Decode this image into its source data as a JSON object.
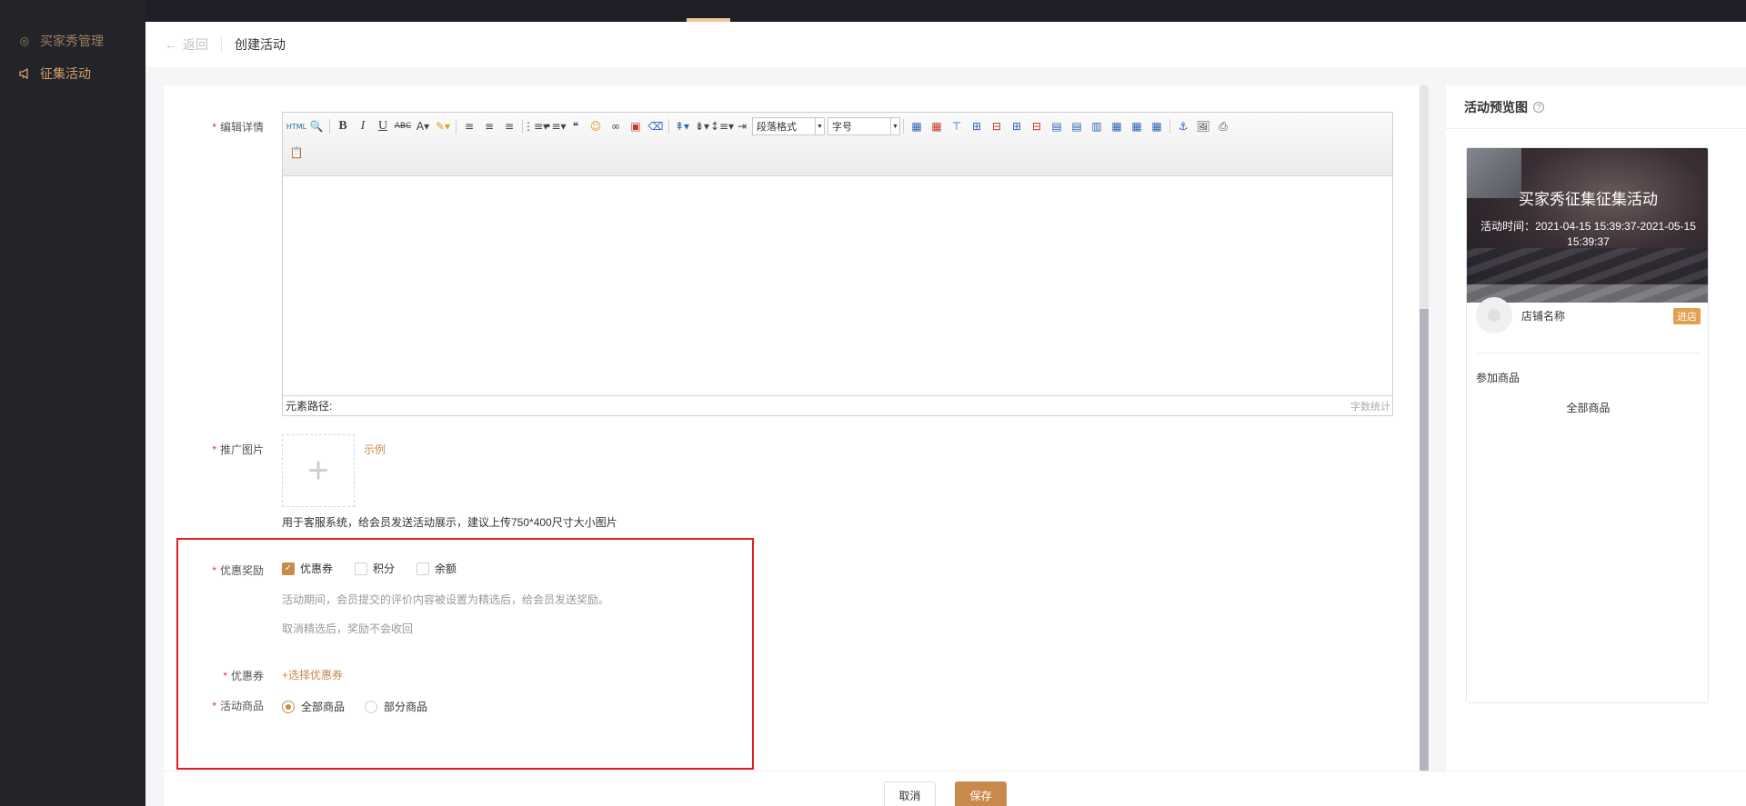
{
  "sidebar": {
    "items": [
      {
        "label": "买家秀管理",
        "icon": "settings-circle-icon"
      },
      {
        "label": "征集活动",
        "icon": "megaphone-icon"
      }
    ]
  },
  "header": {
    "back_label": "返回",
    "title": "创建活动"
  },
  "form": {
    "editor": {
      "label": "编辑详情",
      "paragraph_format": "段落格式",
      "font_size": "字号",
      "path_label": "元素路径:",
      "word_count_label": "字数统计"
    },
    "promo_image": {
      "label": "推广图片",
      "example_link": "示例",
      "hint": "用于客服系统，给会员发送活动展示，建议上传750*400尺寸大小图片"
    },
    "reward": {
      "label": "优惠奖励",
      "options": [
        {
          "label": "优惠券",
          "checked": true
        },
        {
          "label": "积分",
          "checked": false
        },
        {
          "label": "余额",
          "checked": false
        }
      ],
      "hint1": "活动期间，会员提交的评价内容被设置为精选后，给会员发送奖励。",
      "hint2": "取消精选后，奖励不会收回"
    },
    "coupon": {
      "label": "优惠券",
      "select_link": "+选择优惠券"
    },
    "goods": {
      "label": "活动商品",
      "options": [
        {
          "label": "全部商品",
          "selected": true
        },
        {
          "label": "部分商品",
          "selected": false
        }
      ]
    }
  },
  "footer": {
    "cancel_label": "取消",
    "save_label": "保存"
  },
  "preview": {
    "title": "活动预览图",
    "banner_title": "买家秀征集征集活动",
    "banner_time": "活动时间：2021-04-15 15:39:37-2021-05-15 15:39:37",
    "shop_name": "店铺名称",
    "enter_label": "进店",
    "join_title": "参加商品",
    "all_goods": "全部商品"
  },
  "colors": {
    "accent": "#c88a4c",
    "required": "#e5362b",
    "highlight_box": "#e51c23"
  }
}
